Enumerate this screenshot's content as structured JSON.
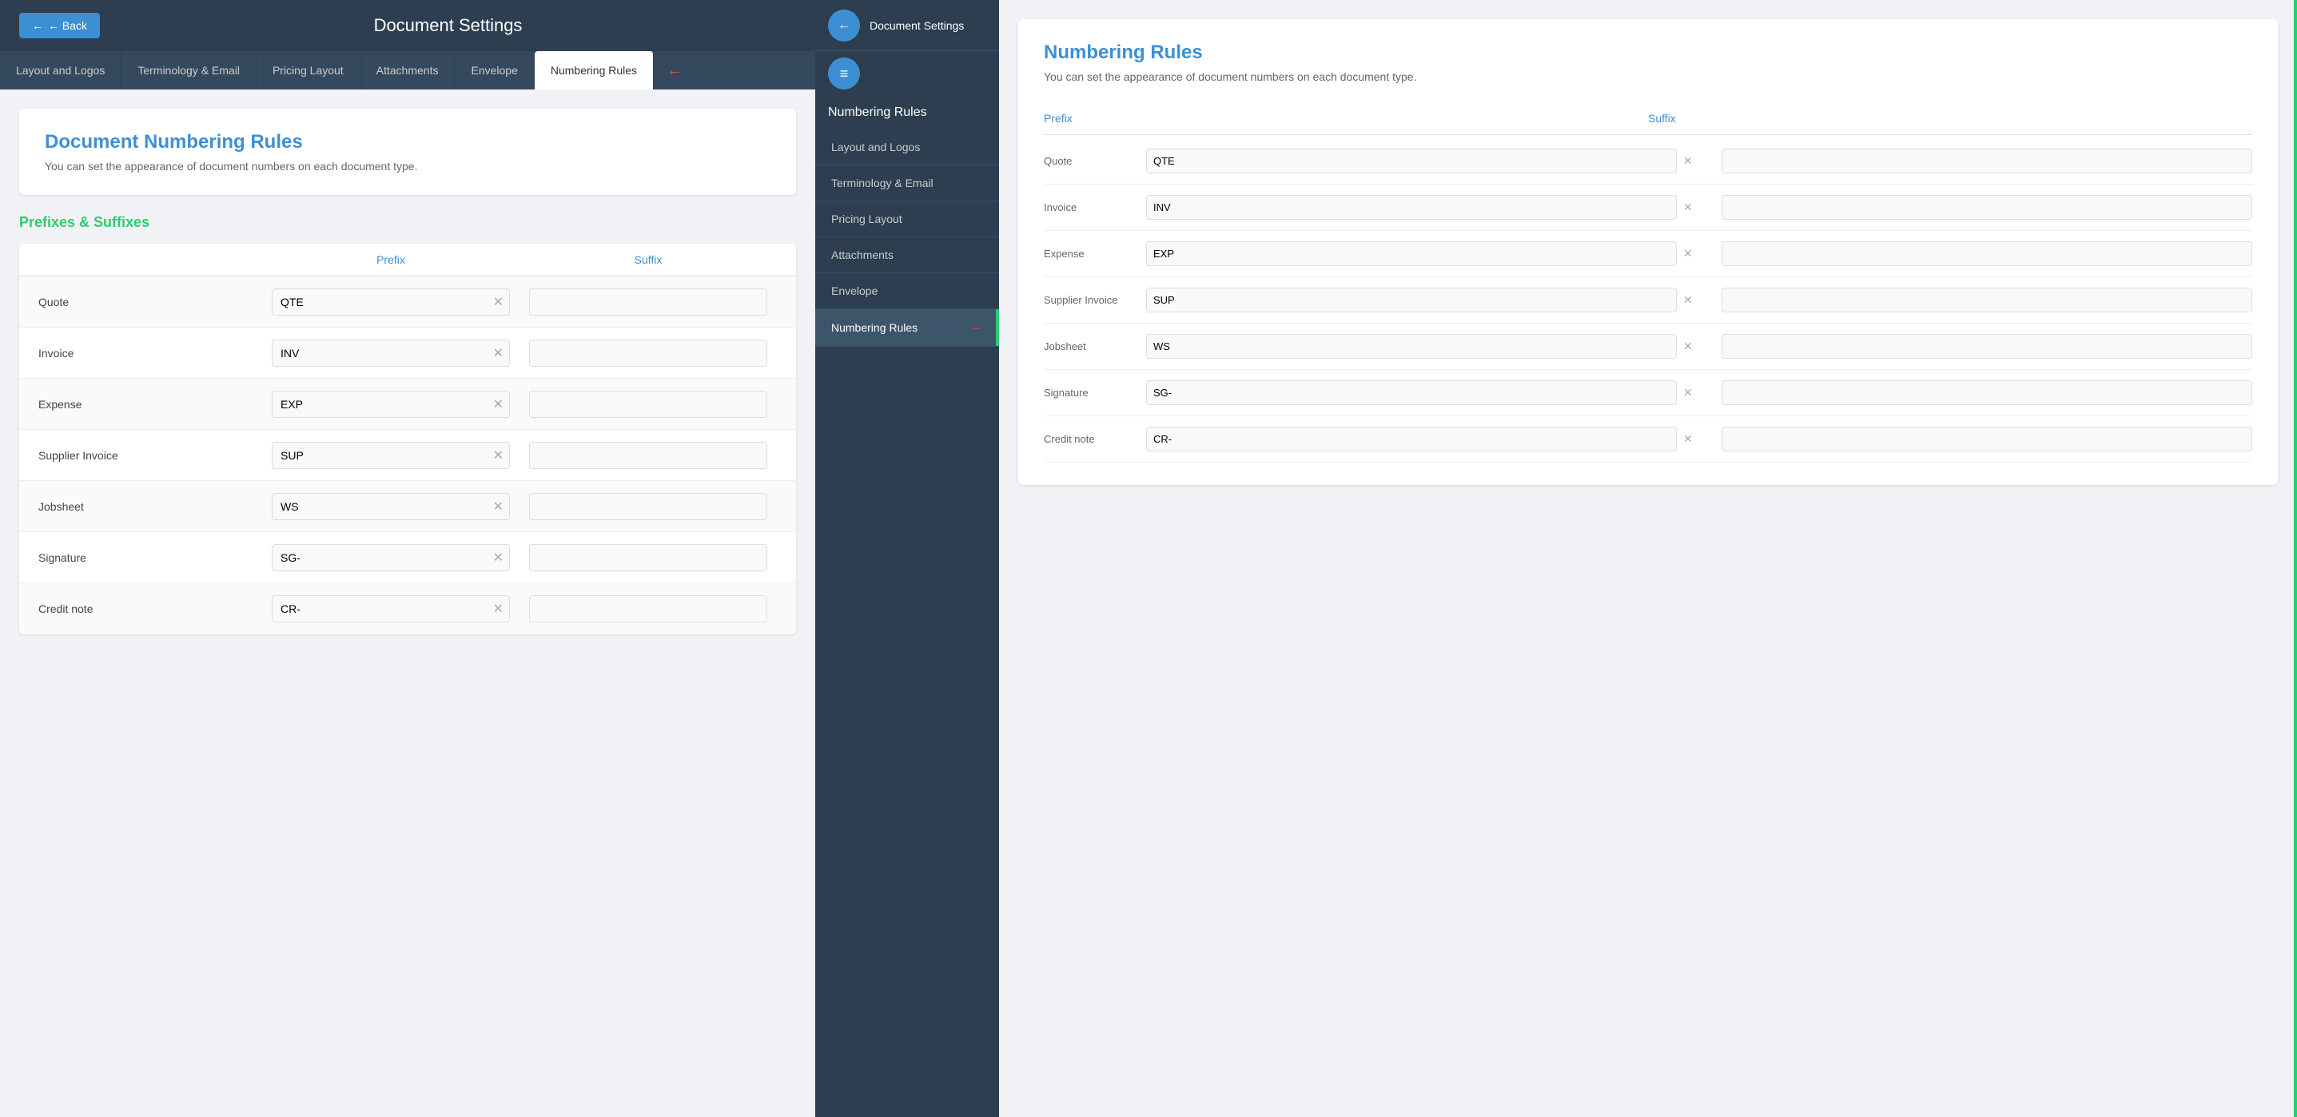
{
  "leftPanel": {
    "topBar": {
      "backLabel": "← Back",
      "title": "Document Settings"
    },
    "tabs": [
      {
        "id": "layout",
        "label": "Layout and Logos",
        "active": false
      },
      {
        "id": "terminology",
        "label": "Terminology & Email",
        "active": false
      },
      {
        "id": "pricing",
        "label": "Pricing Layout",
        "active": false
      },
      {
        "id": "attachments",
        "label": "Attachments",
        "active": false
      },
      {
        "id": "envelope",
        "label": "Envelope",
        "active": false
      },
      {
        "id": "numbering",
        "label": "Numbering Rules",
        "active": true
      }
    ],
    "mainSection": {
      "title": "Document Numbering Rules",
      "subtitle": "You can set the appearance of document numbers on each document type."
    },
    "prefixesSection": {
      "title": "Prefixes & Suffixes",
      "prefixHeader": "Prefix",
      "suffixHeader": "Suffix",
      "rows": [
        {
          "label": "Quote",
          "prefix": "QTE",
          "suffix": ""
        },
        {
          "label": "Invoice",
          "prefix": "INV",
          "suffix": ""
        },
        {
          "label": "Expense",
          "prefix": "EXP",
          "suffix": ""
        },
        {
          "label": "Supplier Invoice",
          "prefix": "SUP",
          "suffix": ""
        },
        {
          "label": "Jobsheet",
          "prefix": "WS",
          "suffix": ""
        },
        {
          "label": "Signature",
          "prefix": "SG-",
          "suffix": ""
        },
        {
          "label": "Credit note",
          "prefix": "CR-",
          "suffix": ""
        }
      ]
    }
  },
  "rightPanel": {
    "sidebar": {
      "backBtnIcon": "←",
      "menuBtnIcon": "≡",
      "docSettingsLabel": "Document Settings",
      "pageTitle": "Numbering Rules",
      "navItems": [
        {
          "id": "layout",
          "label": "Layout and Logos",
          "active": false
        },
        {
          "id": "terminology",
          "label": "Terminology & Email",
          "active": false
        },
        {
          "id": "pricing",
          "label": "Pricing Layout",
          "active": false
        },
        {
          "id": "attachments",
          "label": "Attachments",
          "active": false
        },
        {
          "id": "envelope",
          "label": "Envelope",
          "active": false
        },
        {
          "id": "numbering",
          "label": "Numbering Rules",
          "active": true
        }
      ]
    },
    "content": {
      "title": "Rules",
      "subtitle": "ment numbers on each document type.",
      "prefixHeader": "refix",
      "suffixHeader": "Suffix",
      "rows": [
        {
          "label": "QTE",
          "suffix": ""
        },
        {
          "label": "INV",
          "suffix": ""
        },
        {
          "label": "EXP",
          "suffix": ""
        },
        {
          "label": "SUP",
          "suffix": ""
        },
        {
          "label": "WS",
          "suffix": ""
        },
        {
          "label": "SG-",
          "suffix": ""
        },
        {
          "label": "CR-",
          "suffix": ""
        },
        {
          "label": "CR-",
          "suffix": ""
        }
      ]
    }
  },
  "arrows": {
    "tabArrow": "→",
    "sidebarArrow": "→"
  }
}
